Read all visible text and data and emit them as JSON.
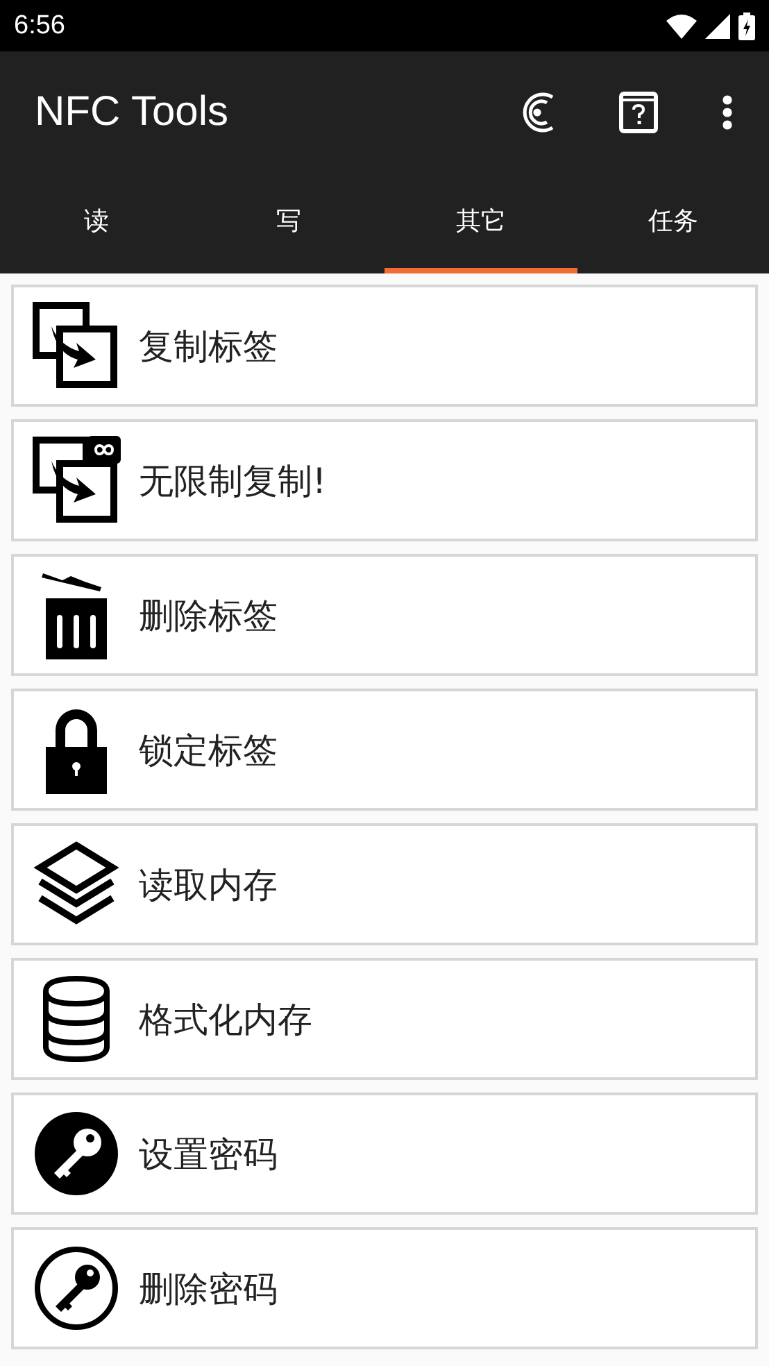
{
  "status_bar": {
    "time": "6:56"
  },
  "app_bar": {
    "title": "NFC Tools"
  },
  "tabs": [
    {
      "label": "读",
      "selected": false
    },
    {
      "label": "写",
      "selected": false
    },
    {
      "label": "其它",
      "selected": true
    },
    {
      "label": "任务",
      "selected": false
    }
  ],
  "items": [
    {
      "kind": "copy",
      "label": "复制标签"
    },
    {
      "kind": "copy-unlimited",
      "label": "无限制复制!"
    },
    {
      "kind": "erase",
      "label": "删除标签"
    },
    {
      "kind": "lock",
      "label": "锁定标签"
    },
    {
      "kind": "read-memory",
      "label": "读取内存"
    },
    {
      "kind": "format-memory",
      "label": "格式化内存"
    },
    {
      "kind": "set-password",
      "label": "设置密码"
    },
    {
      "kind": "remove-password",
      "label": "删除密码"
    }
  ]
}
